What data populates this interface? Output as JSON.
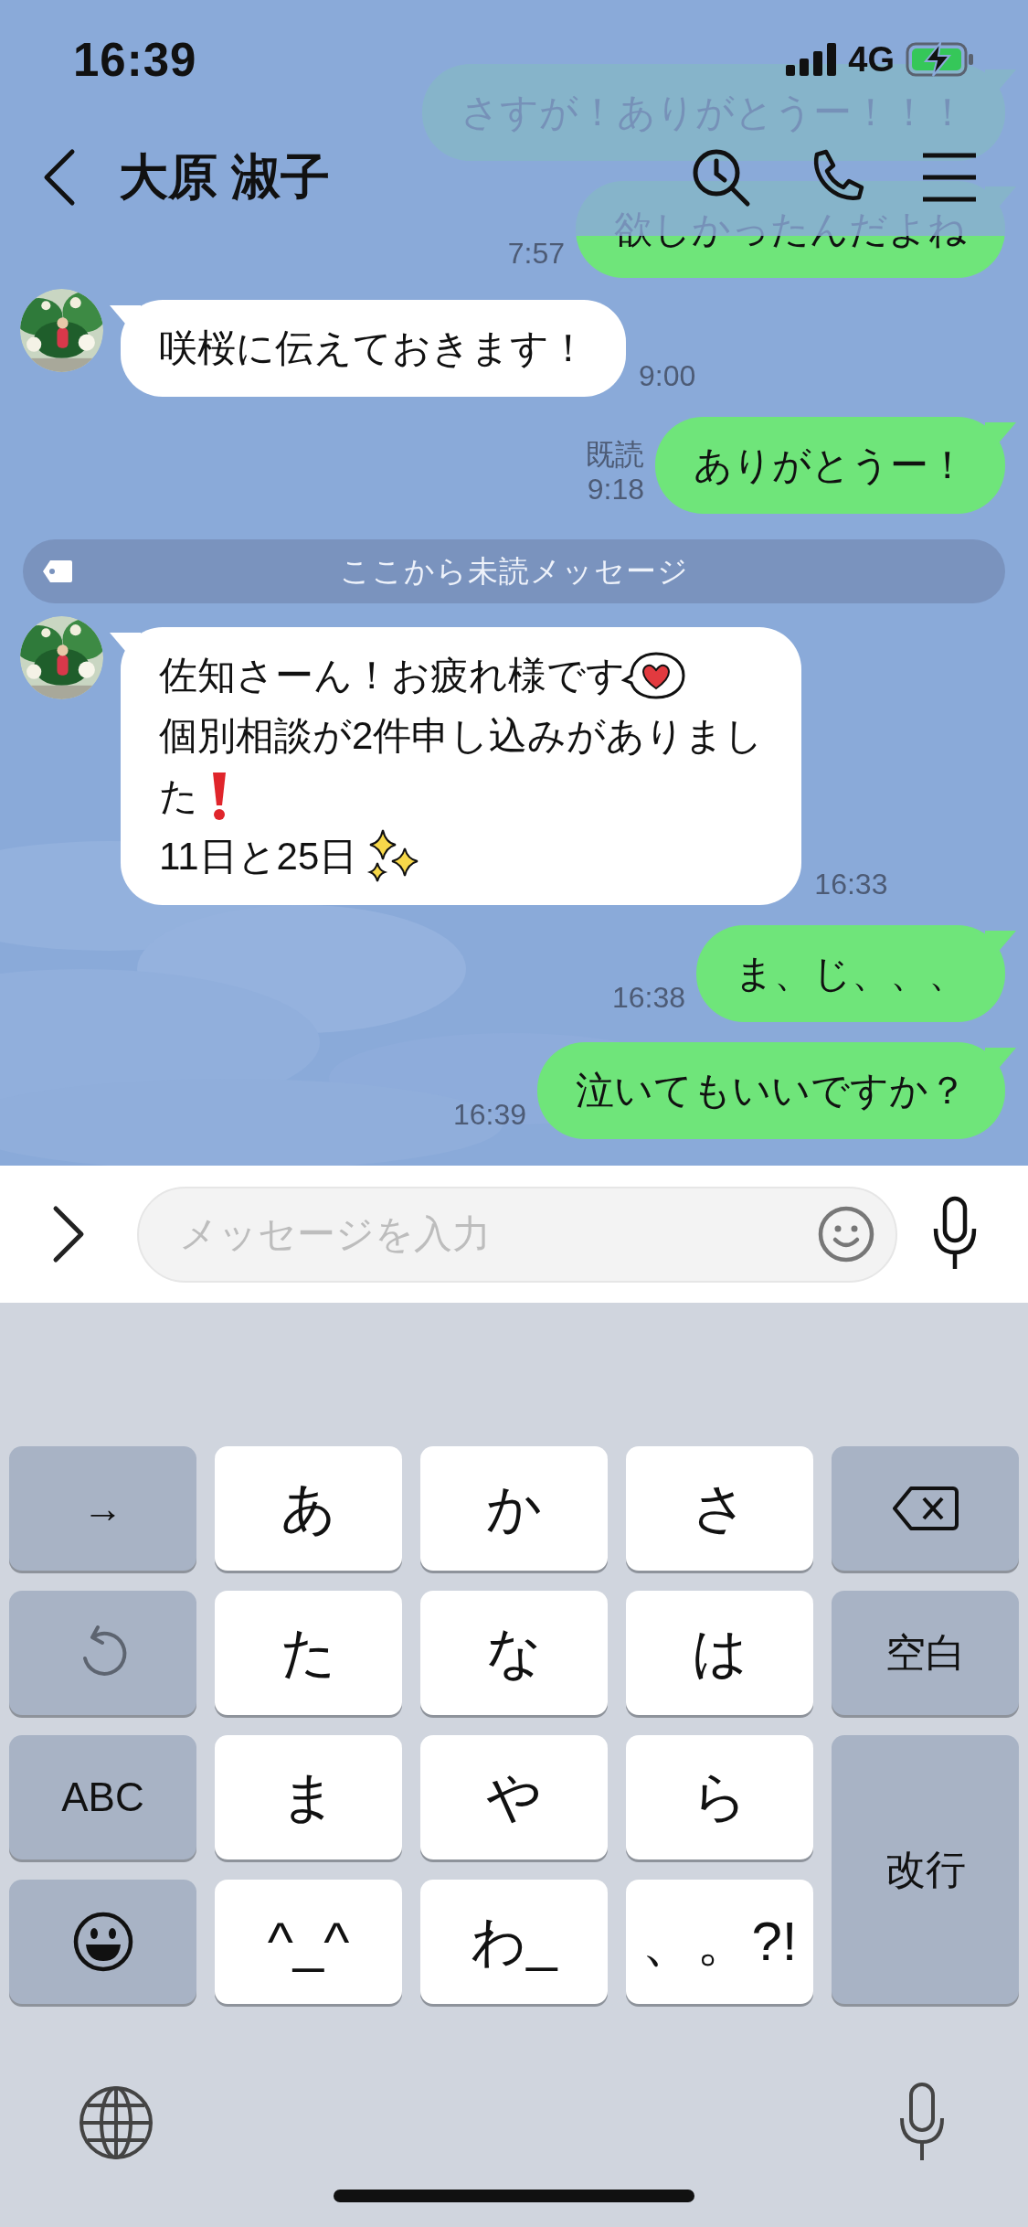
{
  "status_bar": {
    "time": "16:39",
    "network": "4G"
  },
  "header": {
    "title": "大原 淑子"
  },
  "messages": [
    {
      "kind": "outgoing",
      "lines": [
        {
          "text": "さすが！ありがとうー！！！"
        }
      ]
    },
    {
      "kind": "outgoing",
      "lines": [
        {
          "text": "欲しかったんだよね"
        }
      ],
      "time": "7:57"
    },
    {
      "kind": "incoming",
      "lines": [
        {
          "text": "咲桜に伝えておきます！"
        }
      ],
      "time": "9:00"
    },
    {
      "kind": "outgoing",
      "lines": [
        {
          "text": "ありがとうー！"
        }
      ],
      "read": "既読",
      "time": "9:18"
    },
    {
      "kind": "unread-divider",
      "text": "ここから未読メッセージ"
    },
    {
      "kind": "incoming",
      "lines": [
        {
          "text": "佐知さーん！お疲れ様です",
          "kind": "heart"
        },
        {
          "text": "個別相談が2件申し込みがありまし"
        },
        {
          "text": "た",
          "kind": "exclamation"
        },
        {
          "text": "11日と25日",
          "kind": "sparkles"
        }
      ],
      "time": "16:33"
    },
    {
      "kind": "outgoing",
      "lines": [
        {
          "text": "ま、じ、、、"
        }
      ],
      "time": "16:38"
    },
    {
      "kind": "outgoing",
      "lines": [
        {
          "text": "泣いてもいいですか？"
        }
      ],
      "time": "16:39"
    }
  ],
  "input": {
    "placeholder": "メッセージを入力"
  },
  "keyboard": {
    "keys": [
      {
        "kind": "function",
        "label": "→"
      },
      {
        "kind": "kana",
        "label": "あ"
      },
      {
        "kind": "kana",
        "label": "か"
      },
      {
        "kind": "kana",
        "label": "さ"
      },
      {
        "kind": "backspace"
      },
      {
        "kind": "undo"
      },
      {
        "kind": "kana",
        "label": "た"
      },
      {
        "kind": "kana",
        "label": "な"
      },
      {
        "kind": "kana",
        "label": "は"
      },
      {
        "kind": "function",
        "label": "空白"
      },
      {
        "kind": "function",
        "label": "ABC"
      },
      {
        "kind": "kana",
        "label": "ま"
      },
      {
        "kind": "kana",
        "label": "や"
      },
      {
        "kind": "kana",
        "label": "ら"
      },
      {
        "kind": "enter",
        "label": "改行"
      },
      {
        "kind": "emoji"
      },
      {
        "kind": "kana",
        "label": "^_^"
      },
      {
        "kind": "kana",
        "label": "わ_"
      },
      {
        "kind": "kana",
        "label": "、。?!"
      }
    ]
  }
}
